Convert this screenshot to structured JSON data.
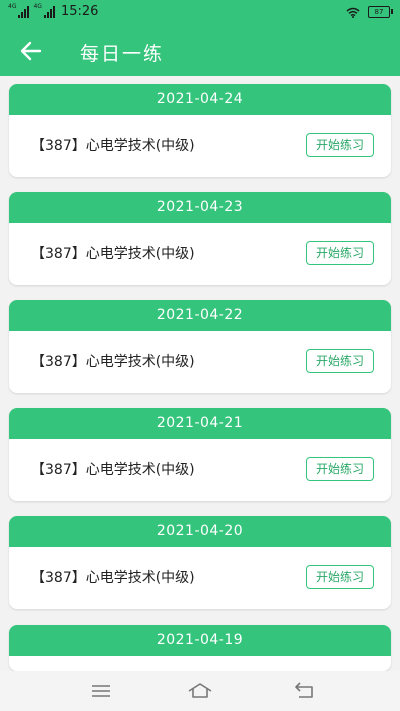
{
  "status_bar": {
    "network_labels": [
      "4G",
      "4G"
    ],
    "time": "15:26",
    "battery": "87"
  },
  "header": {
    "title": "每日一练"
  },
  "exercises": [
    {
      "date": "2021-04-24",
      "title": "【387】心电学技术(中级)",
      "button": "开始练习"
    },
    {
      "date": "2021-04-23",
      "title": "【387】心电学技术(中级)",
      "button": "开始练习"
    },
    {
      "date": "2021-04-22",
      "title": "【387】心电学技术(中级)",
      "button": "开始练习"
    },
    {
      "date": "2021-04-21",
      "title": "【387】心电学技术(中级)",
      "button": "开始练习"
    },
    {
      "date": "2021-04-20",
      "title": "【387】心电学技术(中级)",
      "button": "开始练习"
    },
    {
      "date": "2021-04-19",
      "title": "",
      "button": ""
    }
  ],
  "colors": {
    "accent": "#34c47c",
    "button_text": "#2aa868",
    "background": "#f2f2f2"
  },
  "icons": [
    "back-arrow-icon",
    "wifi-icon",
    "battery-icon",
    "signal-icon",
    "menu-icon",
    "home-icon",
    "back-nav-icon"
  ]
}
